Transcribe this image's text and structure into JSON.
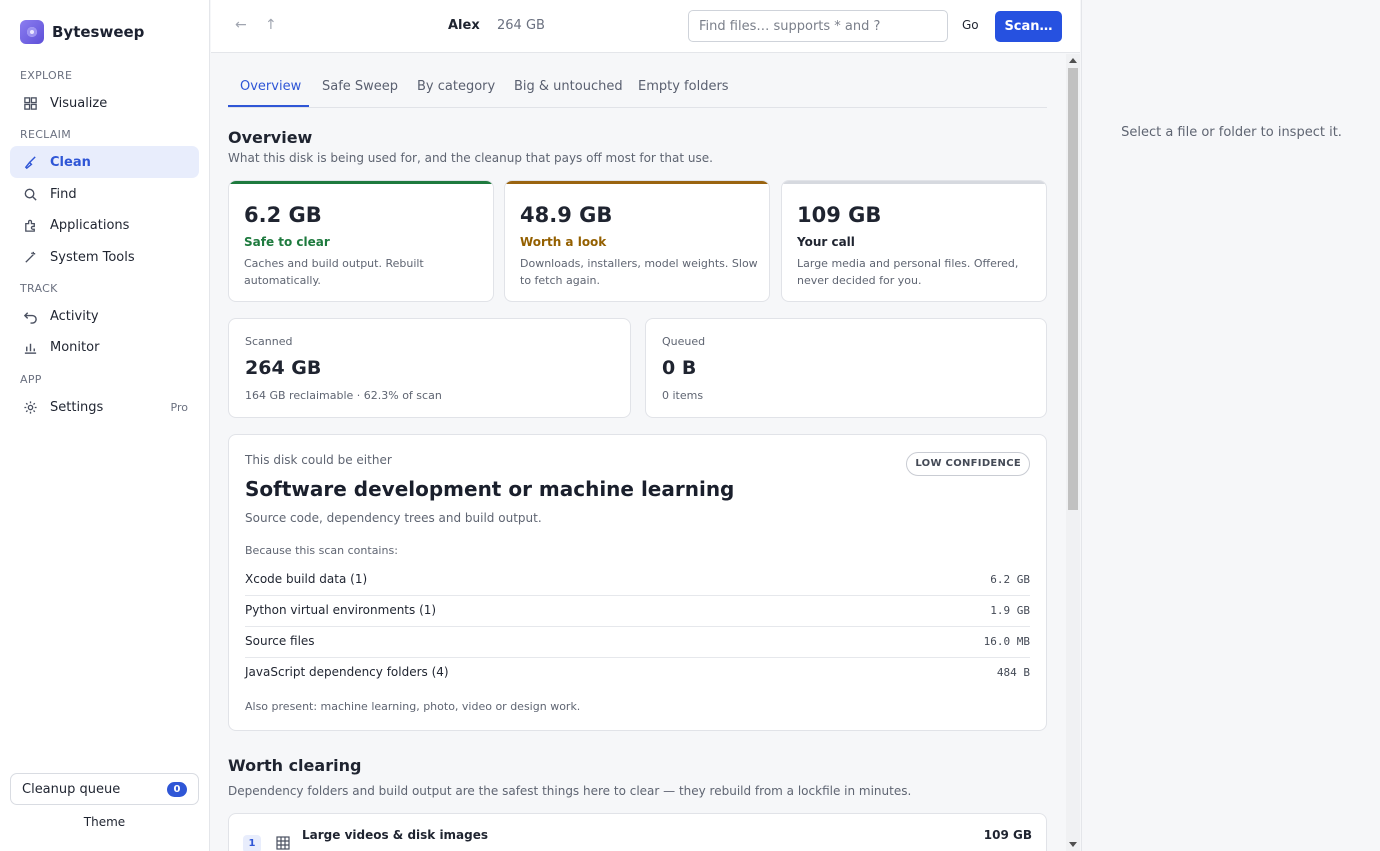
{
  "app": {
    "name": "Bytesweep"
  },
  "sidebar": {
    "sections": [
      "EXPLORE",
      "RECLAIM",
      "TRACK",
      "APP"
    ],
    "items": [
      {
        "label": "Visualize"
      },
      {
        "label": "Clean"
      },
      {
        "label": "Find"
      },
      {
        "label": "Applications"
      },
      {
        "label": "System Tools"
      },
      {
        "label": "Activity"
      },
      {
        "label": "Monitor"
      },
      {
        "label": "Settings",
        "badge": "Pro"
      }
    ],
    "queue": {
      "label": "Cleanup queue",
      "count": "0"
    },
    "theme_label": "Theme"
  },
  "topbar": {
    "user": "Alex",
    "disk_size": "264 GB",
    "search_placeholder": "Find files… supports * and ?",
    "go_label": "Go",
    "scan_label": "Scan…"
  },
  "tabs": [
    "Overview",
    "Safe Sweep",
    "By category",
    "Big & untouched",
    "Empty folders"
  ],
  "overview": {
    "title": "Overview",
    "subtitle": "What this disk is being used for, and the cleanup that pays off most for that use.",
    "buckets": [
      {
        "value": "6.2 GB",
        "label": "Safe to clear",
        "desc": "Caches and build output. Rebuilt automatically.",
        "color": "#1e7a3e",
        "accent": "#1e7a3e"
      },
      {
        "value": "48.9 GB",
        "label": "Worth a look",
        "desc": "Downloads, installers, model weights. Slow to fetch again.",
        "color": "#946000",
        "accent": "#9a6410"
      },
      {
        "value": "109 GB",
        "label": "Your call",
        "desc": "Large media and personal files. Offered, never decided for you.",
        "color": "#1f2430",
        "accent": "#d6d9df"
      }
    ],
    "kpis": [
      {
        "label": "Scanned",
        "value": "264 GB",
        "sub": "164 GB reclaimable · 62.3% of scan"
      },
      {
        "label": "Queued",
        "value": "0 B",
        "sub": "0 items"
      }
    ]
  },
  "profile": {
    "eyebrow": "This disk could be either",
    "badge": "LOW CONFIDENCE",
    "title": "Software development or machine learning",
    "desc": "Source code, dependency trees and build output.",
    "because": "Because this scan contains:",
    "rows": [
      {
        "name": "Xcode build data (1)",
        "size": "6.2 GB"
      },
      {
        "name": "Python virtual environments (1)",
        "size": "1.9 GB"
      },
      {
        "name": "Source files",
        "size": "16.0 MB"
      },
      {
        "name": "JavaScript dependency folders (4)",
        "size": "484 B"
      }
    ],
    "also": "Also present: machine learning, photo, video or design work."
  },
  "worth": {
    "title": "Worth clearing",
    "subtitle": "Dependency folders and build output are the safest things here to clear — they rebuild from a lockfile in minutes.",
    "items": [
      {
        "num": "1",
        "title": "Large videos & disk images",
        "size": "109 GB"
      }
    ]
  },
  "inspector": {
    "empty_text": "Select a file or folder to inspect it."
  },
  "colors": {
    "accent": "#2651e0",
    "active_bg": "#e8edfc"
  }
}
